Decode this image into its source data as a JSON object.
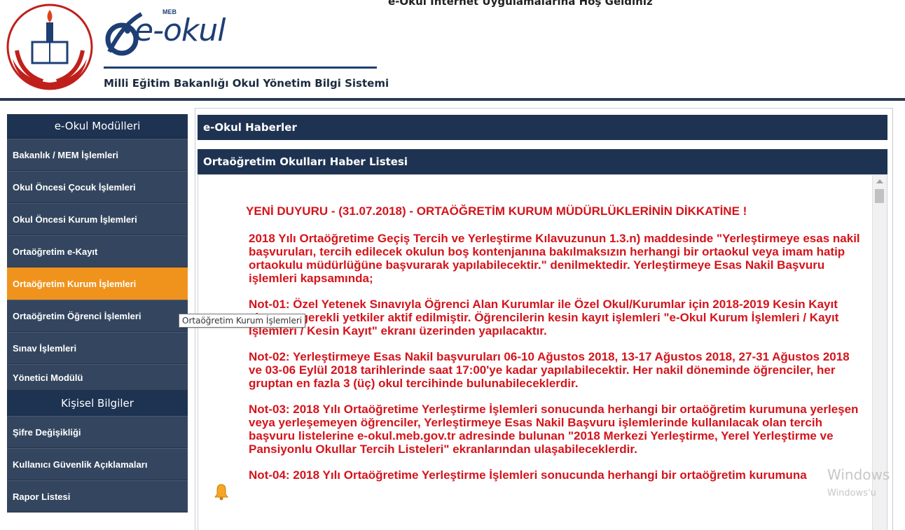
{
  "header": {
    "welcome_text": "e-Okul İnternet Uygulamalarına Hoş Geldiniz",
    "logo_text": "e-okul",
    "logo_mark": "MEB",
    "subtitle": "Milli Eğitim Bakanlığı Okul Yönetim Bilgi Sistemi"
  },
  "sidebar": {
    "modules_title": "e-Okul Modülleri",
    "items": [
      {
        "label": "Bakanlık / MEM İşlemleri"
      },
      {
        "label": "Okul Öncesi Çocuk İşlemleri"
      },
      {
        "label": "Okul Öncesi Kurum İşlemleri"
      },
      {
        "label": "Ortaöğretim e-Kayıt"
      },
      {
        "label": "Ortaöğretim Kurum İşlemleri"
      },
      {
        "label": "Ortaöğretim Öğrenci İşlemleri"
      },
      {
        "label": "Sınav İşlemleri"
      },
      {
        "label": "Yönetici Modülü"
      }
    ],
    "personal_title": "Kişisel Bilgiler",
    "personal_items": [
      {
        "label": "Şifre Değişikliği"
      },
      {
        "label": "Kullanıcı Güvenlik Açıklamaları"
      },
      {
        "label": "Rapor Listesi"
      }
    ]
  },
  "content": {
    "news_header": "e-Okul Haberler",
    "list_header": "Ortaöğretim Okulları Haber Listesi",
    "headline": "YENİ DUYURU - (31.07.2018) - ORTAÖĞRETİM KURUM MÜDÜRLÜKLERİNİN DİKKATİNE !",
    "para1": "2018 Yılı Ortaöğretime Geçiş Tercih ve Yerleştirme Kılavuzunun 1.3.n) maddesinde \"Yerleştirmeye esas nakil başvuruları, tercih edilecek okulun boş kontenjanına bakılmaksızın herhangi bir ortaokul veya imam hatip ortaokulu müdürlüğüne başvurarak yapılabilecektir.\" denilmektedir. Yerleştirmeye Esas Nakil Başvuru işlemleri kapsamında;",
    "para2": "Not-01: Özel Yetenek Sınavıyla Öğrenci Alan Kurumlar ile Özel Okul/Kurumlar için 2018-2019 Kesin Kayıt ekranına gerekli yetkiler aktif edilmiştir. Öğrencilerin kesin kayıt işlemleri \"e-Okul Kurum İşlemleri / Kayıt İşlemleri / Kesin Kayıt\" ekranı üzerinden yapılacaktır.",
    "para3": "Not-02: Yerleştirmeye Esas Nakil başvuruları 06-10 Ağustos 2018, 13-17 Ağustos 2018, 27-31 Ağustos 2018 ve 03-06 Eylül 2018 tarihlerinde saat 17:00'ye kadar yapılabilecektir. Her nakil döneminde öğrenciler, her gruptan en fazla 3 (üç) okul tercihinde bulunabileceklerdir.",
    "para4": "Not-03: 2018 Yılı Ortaöğretime Yerleştirme İşlemleri sonucunda herhangi bir ortaöğretim kurumuna yerleşen veya yerleşemeyen öğrenciler, Yerleştirmeye Esas Nakil Başvuru işlemlerinde kullanılacak olan tercih başvuru listelerine e-okul.meb.gov.tr adresinde bulunan \"2018 Merkezi Yerleştirme, Yerel Yerleştirme ve Pansiyonlu Okullar Tercih Listeleri\" ekranlarından ulaşabileceklerdir.",
    "para5": "Not-04: 2018 Yılı Ortaöğretime Yerleştirme İşlemleri sonucunda herhangi bir ortaöğretim kurumuna"
  },
  "tooltip": "Ortaöğretim Kurum İşlemleri",
  "watermark": {
    "line1": "Windows",
    "line2": "Windows'u"
  },
  "colors": {
    "navy": "#1e3352",
    "sidebar_item": "#34465f",
    "active_orange": "#f0931d",
    "news_red": "#d4141b"
  },
  "icons": {
    "bell": "bell-icon",
    "seal": "ministry-seal-icon",
    "logo": "e-okul-logo-icon"
  }
}
